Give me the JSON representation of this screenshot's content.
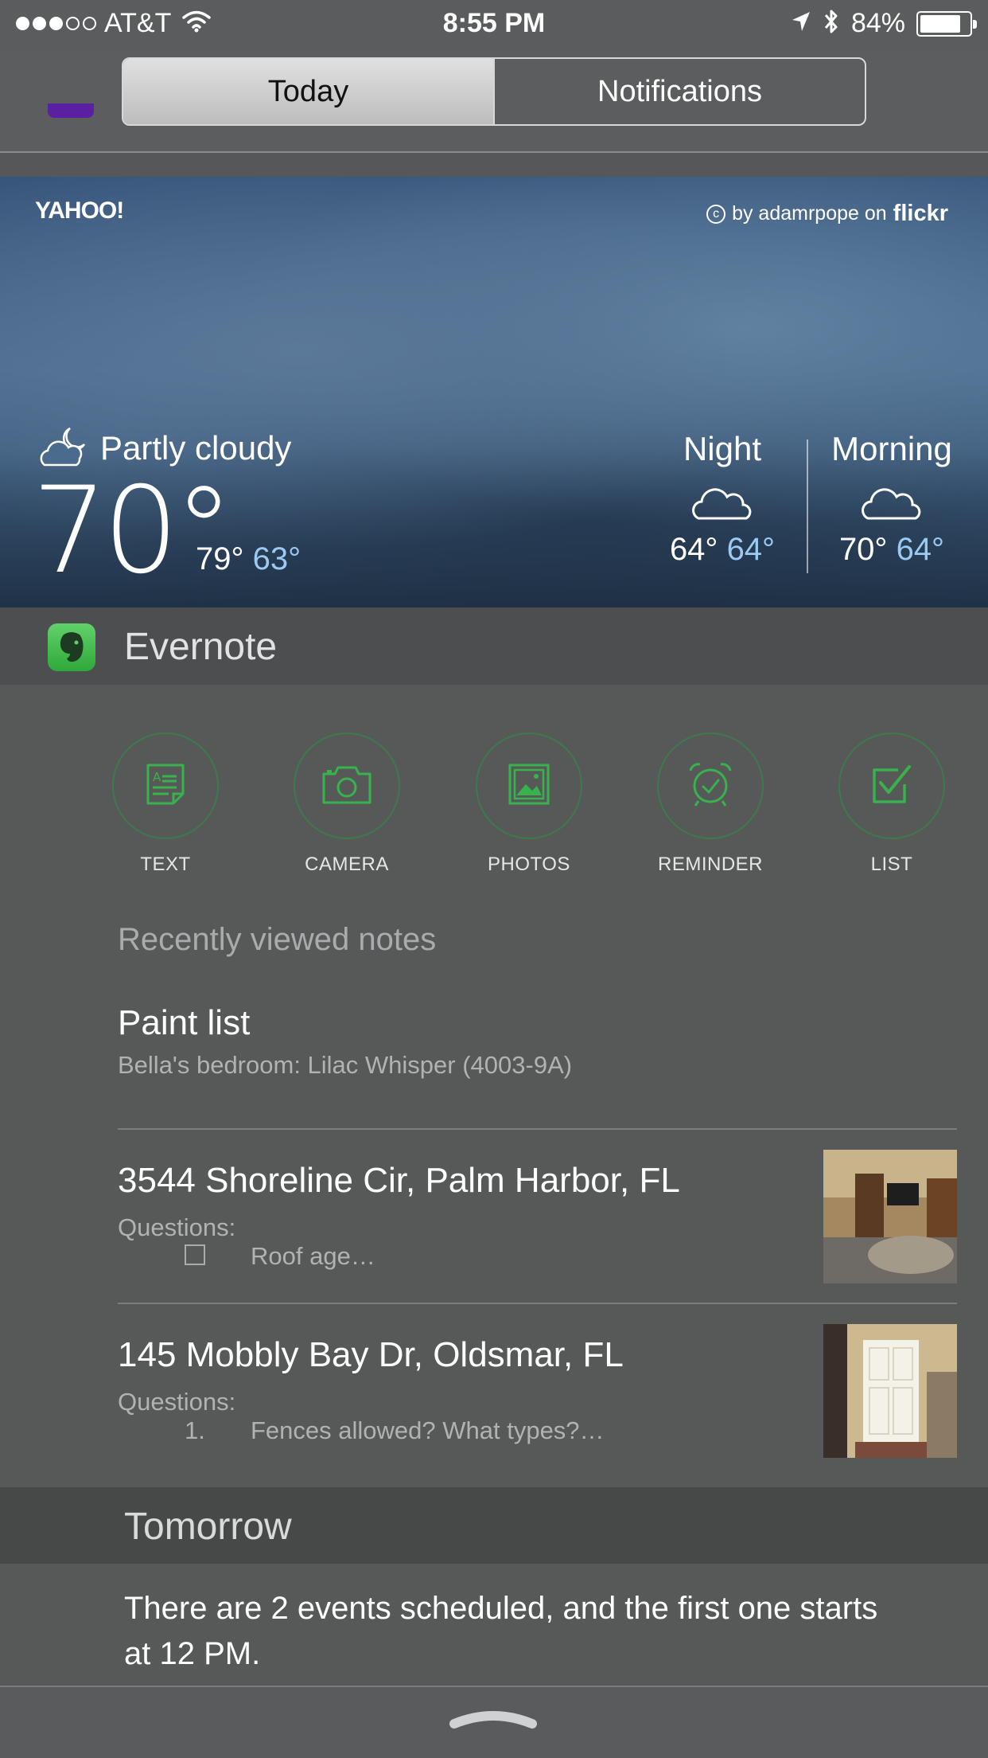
{
  "status_bar": {
    "carrier": "AT&T",
    "time": "8:55 PM",
    "battery_percent": "84%",
    "battery_level": 0.84,
    "signal_bars_filled": 3,
    "signal_bars_total": 5
  },
  "segmented": {
    "today_label": "Today",
    "notifications_label": "Notifications",
    "selected": "Today"
  },
  "weather": {
    "brand": "YAHOO!",
    "photo_credit": "by adamrpope on",
    "photo_source": "flickr",
    "condition": "Partly cloudy",
    "current_temp": "70°",
    "high": "79°",
    "low": "63°",
    "forecast": [
      {
        "label": "Night",
        "high": "64°",
        "low": "64°",
        "icon": "cloud-icon"
      },
      {
        "label": "Morning",
        "high": "70°",
        "low": "64°",
        "icon": "cloud-icon"
      }
    ]
  },
  "evernote": {
    "title": "Evernote",
    "actions": [
      {
        "label": "TEXT",
        "icon": "text-note-icon"
      },
      {
        "label": "CAMERA",
        "icon": "camera-icon"
      },
      {
        "label": "PHOTOS",
        "icon": "photos-icon"
      },
      {
        "label": "REMINDER",
        "icon": "alarm-clock-icon"
      },
      {
        "label": "LIST",
        "icon": "checkbox-icon"
      }
    ],
    "recent_heading": "Recently viewed notes",
    "notes": [
      {
        "title": "Paint list",
        "snippet": "Bella's bedroom: Lilac Whisper (4003-9A)"
      },
      {
        "title": "3544 Shoreline Cir, Palm Harbor, FL",
        "subtitle": "Questions:",
        "item": "Roof age…"
      },
      {
        "title": "145 Mobbly Bay Dr, Oldsmar, FL",
        "subtitle": "Questions:",
        "item_number": "1.",
        "item": "Fences allowed?  What types?…"
      }
    ]
  },
  "tomorrow": {
    "title": "Tomorrow",
    "summary": "There are 2 events scheduled, and the first one starts at 12 PM."
  },
  "colors": {
    "accent_green": "#2fa83b",
    "low_temp_blue": "#9bcaf2",
    "yahoo_purple": "#5b1fa3"
  }
}
